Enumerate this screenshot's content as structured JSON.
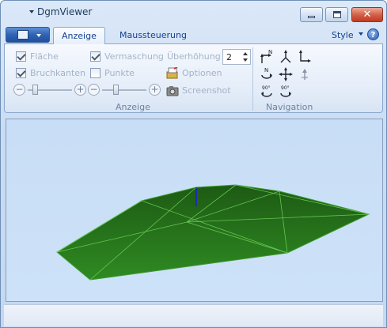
{
  "window": {
    "title": "DgmViewer"
  },
  "ribbon": {
    "tabs": [
      {
        "label": "Anzeige",
        "active": true
      },
      {
        "label": "Maussteuerung",
        "active": false
      }
    ],
    "style_label": "Style",
    "help_label": "?"
  },
  "anzeige": {
    "group_label": "Anzeige",
    "flaeche": {
      "label": "Fläche",
      "checked": true
    },
    "bruchkanten": {
      "label": "Bruchkanten",
      "checked": true
    },
    "vermaschung": {
      "label": "Vermaschung",
      "checked": true
    },
    "punkte": {
      "label": "Punkte",
      "checked": false
    },
    "ueberhoehung_label": "Überhöhung",
    "ueberhoehung_value": "2",
    "optionen_label": "Optionen",
    "screenshot_label": "Screenshot",
    "slider1": {
      "minus": "−",
      "plus": "+"
    },
    "slider2": {
      "minus": "−",
      "plus": "+"
    }
  },
  "navigation": {
    "group_label": "Navigation",
    "icons": [
      "rotate-north-icon",
      "axes-icon",
      "rotate-right-icon",
      "north-turn-icon",
      "pan-icon",
      "up-arrow-icon",
      "rotate-90-left-icon",
      "rotate-90-right-icon"
    ],
    "ninety_label": "90°",
    "north_label": "N"
  },
  "colors": {
    "terrain": "#2d7a1f",
    "terrain_dark": "#1f5c15",
    "mesh_line": "#7cd86a",
    "viewport_bg": "#c8def6"
  }
}
